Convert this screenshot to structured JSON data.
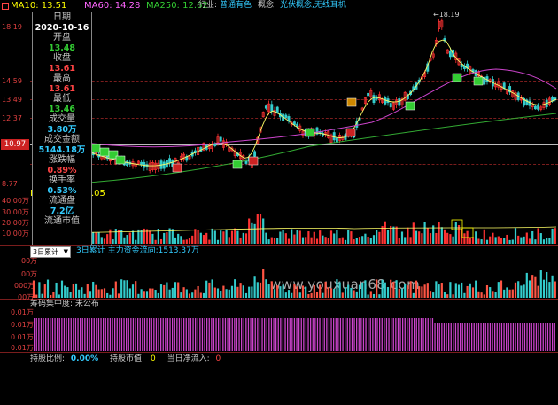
{
  "topbar": {
    "ma10": "MA10: 13.51",
    "ma60": "MA60: 14.28",
    "ma250": "MA250: 12.62",
    "industry_label": "行业:",
    "industry_value": "普通有色",
    "concept_label": "概念:",
    "concept_value": "光伏概念,无线耳机",
    "colors": {
      "ma10": "#ffff00",
      "ma60": "#ff66ff",
      "ma250": "#33cc33",
      "cyan": "#33ccff"
    }
  },
  "price_axis": {
    "labels": [
      "18.19",
      "14.59",
      "13.49",
      "12.37",
      "10.97",
      "8.77"
    ],
    "current_price": "10.97",
    "high_marker": "18.19"
  },
  "infobox": {
    "rows": [
      {
        "k": "日期",
        "v": "2020-10-16",
        "c": "#ffffff"
      },
      {
        "k": "开盘",
        "v": "13.48",
        "c": "#33cc33"
      },
      {
        "k": "收盘",
        "v": "13.61",
        "c": "#ff4444"
      },
      {
        "k": "最高",
        "v": "13.61",
        "c": "#ff4444"
      },
      {
        "k": "最低",
        "v": "13.46",
        "c": "#33cc33"
      },
      {
        "k": "成交量",
        "v": "3.80万",
        "c": "#33ccff"
      },
      {
        "k": "成交金额",
        "v": "5144.18万",
        "c": "#33ccff"
      },
      {
        "k": "涨跌幅",
        "v": "0.89%",
        "c": "#ff4444"
      },
      {
        "k": "换手率",
        "v": "0.53%",
        "c": "#33ccff"
      },
      {
        "k": "流通盘",
        "v": "7.2亿",
        "c": "#33ccff"
      },
      {
        "k": "流通市值",
        "v": "",
        "c": "#33ccff"
      }
    ]
  },
  "volume_panel": {
    "partial_label": "M",
    "partial_value": ".05",
    "y_labels": [
      "40.00万",
      "30.00万",
      "20.00万",
      "10.00万"
    ]
  },
  "flow_panel": {
    "select_value": "3日累计",
    "legend": "3日累计  主力资金流向:1513.37万",
    "y_labels": [
      "00万",
      "00万",
      "000万",
      "00万"
    ]
  },
  "chip_panel": {
    "title": "筹码集中度: 未公布",
    "y_labels": [
      "0.01万",
      "0.01万",
      "0.01万",
      "0.01万",
      "0.01万"
    ]
  },
  "footer": {
    "hold_ratio_label": "持股比例:",
    "hold_ratio_value": "0.00%",
    "hold_value_label": "持股市值:",
    "hold_value_value": "0",
    "net_inflow_label": "当日净流入:",
    "net_inflow_value": "0"
  },
  "watermark": "www.youxuan68.com"
}
